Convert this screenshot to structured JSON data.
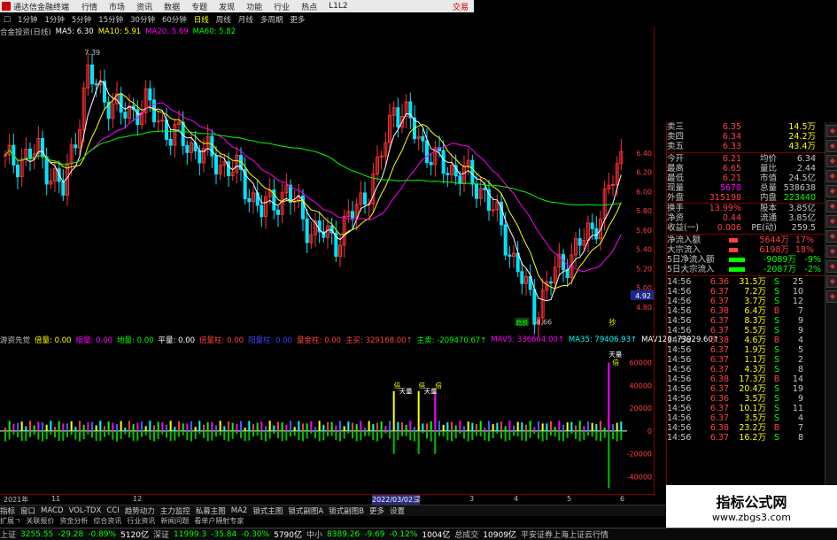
{
  "topbar": {
    "app_title": "通达信金融终端",
    "menus": [
      "行情",
      "市场",
      "资讯",
      "数据",
      "专题",
      "发现",
      "功能",
      "行业",
      "热点",
      "L1L2"
    ],
    "trade": "交易"
  },
  "periodbar": {
    "security_icon": "□",
    "periods": [
      "1分钟",
      "1分钟",
      "5分钟",
      "15分钟",
      "30分钟",
      "60分钟",
      "日线",
      "周线",
      "月线",
      "多周期",
      "更多"
    ]
  },
  "kchart": {
    "title": "合金投资(日线)",
    "ma": [
      {
        "label": "MA5: 6.30",
        "color": "#ffffff"
      },
      {
        "label": "MA10: 5.91",
        "color": "#ffff00"
      },
      {
        "label": "MA20: 5.69",
        "color": "#ff00ff"
      },
      {
        "label": "MA60: 5.82",
        "color": "#00ff00"
      }
    ],
    "price_axis": [
      "6.40",
      "6.20",
      "6.00",
      "5.80",
      "5.60",
      "5.40",
      "5.20",
      "5.00",
      "4.80"
    ],
    "current_price_tag": "4.92",
    "high_label": "7.39",
    "low_label": "4.66",
    "signal_low": "趋跌",
    "signal_right": "抄"
  },
  "volbar": {
    "items": [
      {
        "label": "游资先觉",
        "color": "#c0c0c0"
      },
      {
        "label": "倍量: 0.00",
        "color": "#ffff00"
      },
      {
        "label": "缩量: 0.00",
        "color": "#ff00ff"
      },
      {
        "label": "地量: 0.00",
        "color": "#00ff00"
      },
      {
        "label": "平量: 0.00",
        "color": "#ffffff"
      },
      {
        "label": "倍量柱: 0.00",
        "color": "#ff4040"
      },
      {
        "label": "阳量柱: 0.00",
        "color": "#4040ff"
      },
      {
        "label": "量金柱: 0.00",
        "color": "#ff4040"
      },
      {
        "label": "主买: 329168.00↑",
        "color": "#ff4040"
      },
      {
        "label": "主卖: -209470.67↑",
        "color": "#00ff00"
      },
      {
        "label": "MAV5: 336664.00↑",
        "color": "#ff00ff"
      },
      {
        "label": "MA35: 79406.93↑",
        "color": "#00ffff"
      },
      {
        "label": "MAV120: 73929.60↑",
        "color": "#ffffff"
      }
    ],
    "vol_axis": [
      "60000",
      "40000",
      "20000",
      "0",
      "-20000",
      "-40000"
    ],
    "annotations": [
      "倍",
      "天量",
      "倍",
      "天量",
      "倍",
      "天量",
      "倍"
    ]
  },
  "dates": [
    "2021年",
    "11",
    "12",
    "2022/03/02三",
    "2",
    "3",
    "4",
    "5",
    "6"
  ],
  "tabs": [
    "指标",
    "窗口",
    "MACD",
    "VOL-TDX",
    "CCI",
    "趋势动力",
    "主力监控",
    "私募主图",
    "MA2",
    "锁式主图",
    "锁式副图A",
    "锁式副图B",
    "更多",
    "设置"
  ],
  "tabs2": [
    "扩展ㄱ",
    "关联报价",
    "资金分析",
    "综合资讯",
    "行业资讯",
    "新闻问题",
    "看单户隔射专家"
  ],
  "quote": {
    "ask_rows": [
      {
        "label": "卖三",
        "price": "6.35",
        "vol": "14.5万"
      },
      {
        "label": "卖四",
        "price": "6.34",
        "vol": "24.2万"
      },
      {
        "label": "卖五",
        "price": "6.33",
        "vol": "43.4万"
      }
    ],
    "fund_rows": [
      {
        "a": "今开",
        "b": "6.21",
        "c": "均价",
        "d": "6.34"
      },
      {
        "a": "最高",
        "b": "6.65",
        "c": "量比",
        "d": "2.44"
      },
      {
        "a": "最低",
        "b": "6.21",
        "c": "市值",
        "d": "24.5亿"
      },
      {
        "a": "现量",
        "b": "5678",
        "c": "总量",
        "d": "538638"
      },
      {
        "a": "外盘",
        "b": "315198",
        "c": "内盘",
        "d": "223440"
      },
      {
        "a": "换手",
        "b": "13.99%",
        "c": "股本",
        "d": "3.85亿"
      },
      {
        "a": "净资",
        "b": "0.44",
        "c": "流通",
        "d": "3.85亿"
      },
      {
        "a": "收益(一)",
        "b": "0.006",
        "c": "PE(动)",
        "d": "259.5"
      }
    ],
    "flow_rows": [
      {
        "label": "净流入额",
        "val": "5644万",
        "pct": "17%"
      },
      {
        "label": "大宗流入",
        "val": "6198万",
        "pct": "18%"
      },
      {
        "label": "5日净流入额",
        "val": "-9089万",
        "pct": "-9%"
      },
      {
        "label": "5日大宗流入",
        "val": "-2087万",
        "pct": "-2%"
      }
    ],
    "ticks": [
      {
        "t": "14:56",
        "p": "6.36",
        "v": "31.5万",
        "bs": "S",
        "c": "25"
      },
      {
        "t": "14:56",
        "p": "6.37",
        "v": "7.2万",
        "bs": "S",
        "c": "10"
      },
      {
        "t": "14:56",
        "p": "6.37",
        "v": "3.7万",
        "bs": "S",
        "c": "12"
      },
      {
        "t": "14:56",
        "p": "6.38",
        "v": "6.4万",
        "bs": "B",
        "c": "7"
      },
      {
        "t": "14:56",
        "p": "6.37",
        "v": "8.3万",
        "bs": "S",
        "c": "9"
      },
      {
        "t": "14:56",
        "p": "6.37",
        "v": "5.5万",
        "bs": "S",
        "c": "9"
      },
      {
        "t": "14:56",
        "p": "6.38",
        "v": "4.6万",
        "bs": "B",
        "c": "4"
      },
      {
        "t": "14:56",
        "p": "6.37",
        "v": "1.9万",
        "bs": "S",
        "c": "5"
      },
      {
        "t": "14:56",
        "p": "6.37",
        "v": "1.1万",
        "bs": "S",
        "c": "2"
      },
      {
        "t": "14:56",
        "p": "6.37",
        "v": "4.3万",
        "bs": "S",
        "c": "8"
      },
      {
        "t": "14:56",
        "p": "6.38",
        "v": "17.3万",
        "bs": "B",
        "c": "14"
      },
      {
        "t": "14:56",
        "p": "6.37",
        "v": "20.4万",
        "bs": "S",
        "c": "19"
      },
      {
        "t": "14:56",
        "p": "6.36",
        "v": "3.5万",
        "bs": "S",
        "c": "9"
      },
      {
        "t": "14:56",
        "p": "6.37",
        "v": "10.1万",
        "bs": "S",
        "c": "11"
      },
      {
        "t": "14:56",
        "p": "6.37",
        "v": "3.5万",
        "bs": "S",
        "c": "4"
      },
      {
        "t": "14:56",
        "p": "6.38",
        "v": "23.2万",
        "bs": "B",
        "c": "7"
      },
      {
        "t": "14:56",
        "p": "6.37",
        "v": "16.2万",
        "bs": "S",
        "c": "8"
      }
    ]
  },
  "status": {
    "items": [
      {
        "label": "上证",
        "color": "#c0c0c0"
      },
      {
        "label": "3255.55",
        "color": "#00ff00"
      },
      {
        "label": "-29.28",
        "color": "#00ff00"
      },
      {
        "label": "-0.89%",
        "color": "#00ff00"
      },
      {
        "label": "5120亿",
        "color": "#ffffff"
      },
      {
        "label": "深证",
        "color": "#c0c0c0"
      },
      {
        "label": "11999.3",
        "color": "#00ff00"
      },
      {
        "label": "-35.84",
        "color": "#00ff00"
      },
      {
        "label": "-0.30%",
        "color": "#00ff00"
      },
      {
        "label": "5790亿",
        "color": "#ffffff"
      },
      {
        "label": "中小",
        "color": "#c0c0c0"
      },
      {
        "label": "8389.26",
        "color": "#00ff00"
      },
      {
        "label": "-9.69",
        "color": "#00ff00"
      },
      {
        "label": "-0.12%",
        "color": "#00ff00"
      },
      {
        "label": "1004亿",
        "color": "#ffffff"
      },
      {
        "label": "总成交",
        "color": "#c0c0c0"
      },
      {
        "label": "10909亿",
        "color": "#ffffff"
      },
      {
        "label": "平安证券上海上证云行情",
        "color": "#c0c0c0"
      }
    ]
  },
  "watermark": {
    "line1": "指标公式网",
    "line2": "www.zbgs3.com"
  }
}
